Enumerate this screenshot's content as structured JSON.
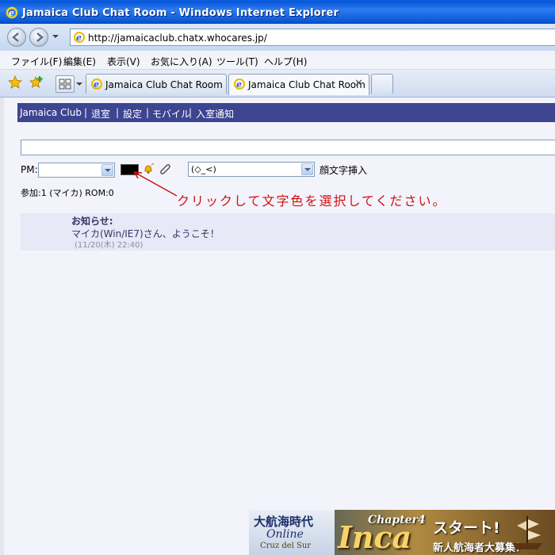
{
  "window": {
    "title": "Jamaica Club Chat Room - Windows Internet Explorer"
  },
  "address": {
    "url": "http://jamaicaclub.chatx.whocares.jp/"
  },
  "menu": {
    "items": [
      "ファイル(F)",
      "編集(E)",
      "表示(V)",
      "お気に入り(A)",
      "ツール(T)",
      "ヘルプ(H)"
    ]
  },
  "tabs": [
    {
      "label": "Jamaica Club Chat Room",
      "active": false
    },
    {
      "label": "Jamaica Club Chat Room",
      "active": true
    }
  ],
  "chat": {
    "nav": [
      "Jamaica Club",
      "退室",
      "設定",
      "モバイル",
      "入室通知"
    ],
    "separator": "|",
    "pm_label": "PM:",
    "pm_selected": "",
    "text_color": "#000000",
    "kaomoji_selected": "(◇_<)",
    "kaomoji_label": "顔文字挿入",
    "participants": "参加:1 (マイカ) ROM:0",
    "annotation": "クリックして文字色を選択してください。",
    "notice": {
      "title": "お知らせ:",
      "message": "マイカ(Win/IE7)さん、ようこそ！",
      "time": "(11/20(木) 22:40)"
    }
  },
  "banner": {
    "title": "大航海時代",
    "online": "Online",
    "subtitle": "Cruz del Sur",
    "chapter": "Chapter4",
    "product": "Inca",
    "headline": "スタート!",
    "recruit": "新人航海者大募集！"
  }
}
